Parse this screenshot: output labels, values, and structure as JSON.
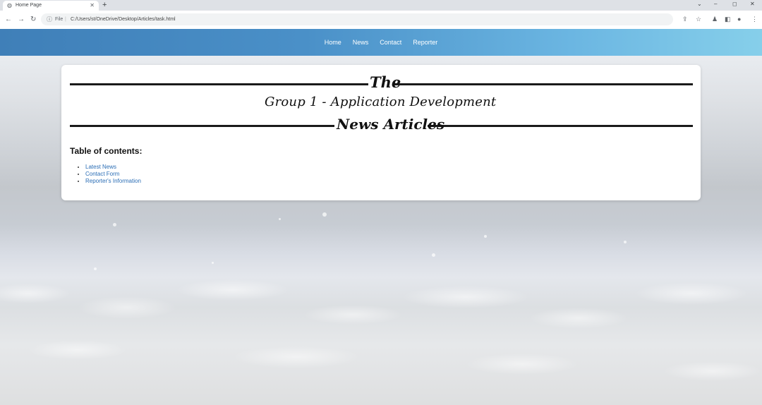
{
  "browser": {
    "tab_title": "Home Page",
    "new_tab_symbol": "+",
    "url_scheme": "File",
    "url": "C:/Users/st/OneDrive/Desktop/Articles/task.html",
    "window_controls": [
      "⌄",
      "–",
      "◻",
      "✕"
    ],
    "icons": [
      "back-icon",
      "forward-icon",
      "reload-icon",
      "info-icon",
      "share-icon",
      "star-icon",
      "extension-icon",
      "sidebar-icon",
      "profile-icon",
      "menu-icon"
    ]
  },
  "nav": {
    "links": [
      "Home",
      "News",
      "Contact",
      "Reporter"
    ]
  },
  "masthead": {
    "line1": "The",
    "line2": "Group 1  - Application Development",
    "line3": "News Articles"
  },
  "toc": {
    "heading": "Table of contents:",
    "items": [
      "Latest News",
      "Contact Form",
      "Reporter's Information"
    ]
  },
  "colors": {
    "navbar_start": "#3f7fb8",
    "navbar_end": "#86cfea",
    "link": "#2a6db5"
  }
}
